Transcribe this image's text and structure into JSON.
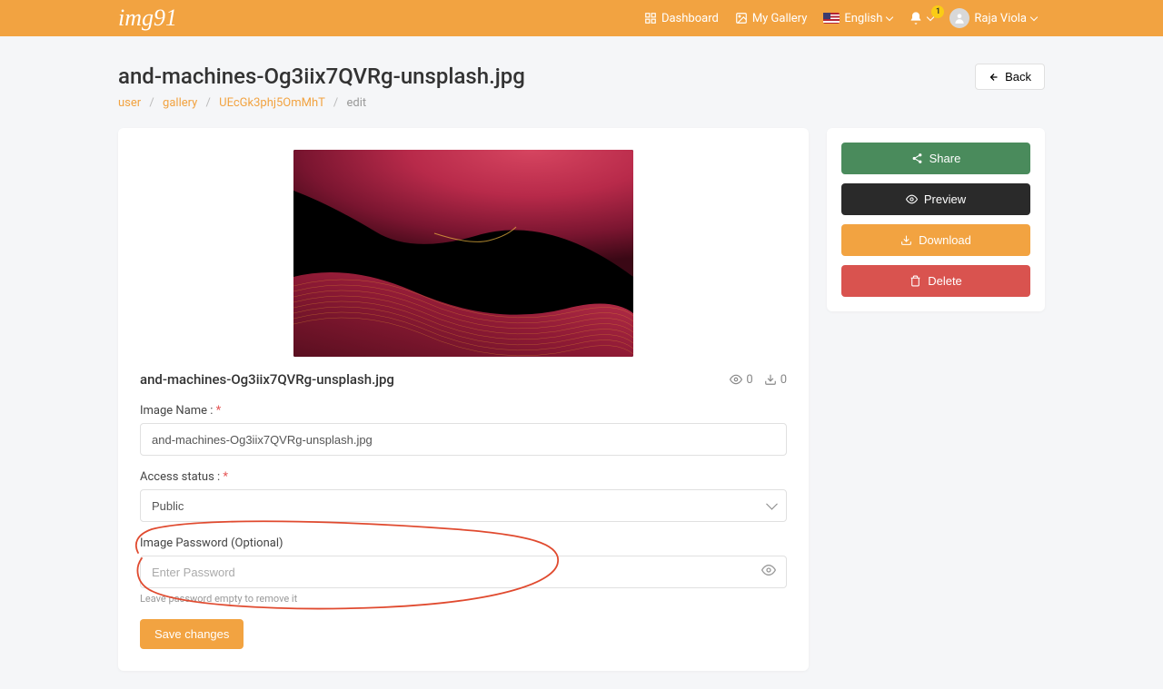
{
  "brand": "img91",
  "nav": {
    "dashboard": "Dashboard",
    "gallery": "My Gallery",
    "language": "English",
    "notification_count": "1",
    "user_name": "Raja Viola"
  },
  "page": {
    "title": "and-machines-Og3iix7QVRg-unsplash.jpg",
    "back_label": "Back"
  },
  "breadcrumb": {
    "user": "user",
    "gallery": "gallery",
    "id": "UEcGk3phj5OmMhT",
    "edit": "edit"
  },
  "image": {
    "filename": "and-machines-Og3iix7QVRg-unsplash.jpg",
    "views": "0",
    "downloads": "0"
  },
  "form": {
    "name_label": "Image Name :",
    "name_value": "and-machines-Og3iix7QVRg-unsplash.jpg",
    "access_label": "Access status :",
    "access_value": "Public",
    "password_label": "Image Password (Optional)",
    "password_placeholder": "Enter Password",
    "password_help": "Leave password empty to remove it",
    "submit": "Save changes"
  },
  "actions": {
    "share": "Share",
    "preview": "Preview",
    "download": "Download",
    "delete": "Delete"
  }
}
